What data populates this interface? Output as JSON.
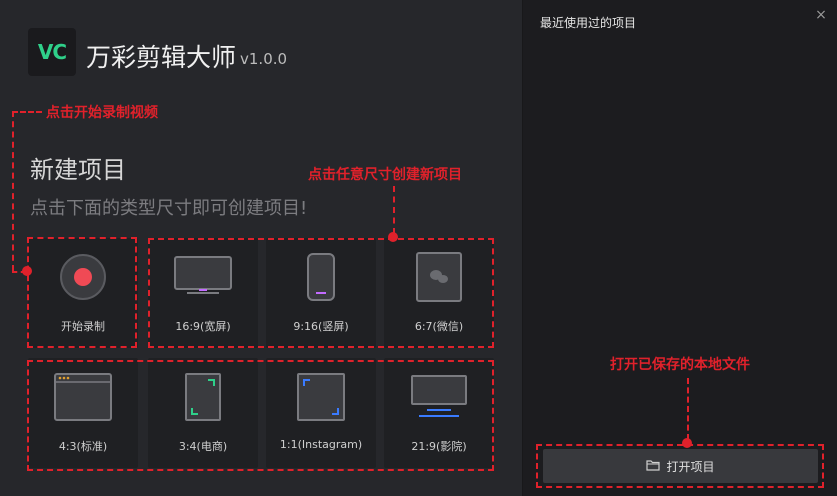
{
  "app": {
    "logo_text": "VC",
    "title": "万彩剪辑大师",
    "version": "v1.0.0"
  },
  "new_project": {
    "title": "新建项目",
    "subtitle": "点击下面的类型尺寸即可创建项目!"
  },
  "tiles": [
    {
      "label": "开始录制",
      "icon": "record-icon"
    },
    {
      "label": "16:9(宽屏)",
      "icon": "monitor-icon"
    },
    {
      "label": "9:16(竖屏)",
      "icon": "phone-icon"
    },
    {
      "label": "6:7(微信)",
      "icon": "wechat-icon"
    },
    {
      "label": "4:3(标准)",
      "icon": "window-icon"
    },
    {
      "label": "3:4(电商)",
      "icon": "portrait-frame-icon"
    },
    {
      "label": "1:1(Instagram)",
      "icon": "square-frame-icon"
    },
    {
      "label": "21:9(影院)",
      "icon": "cinema-icon"
    }
  ],
  "annotations": {
    "record": "点击开始录制视频",
    "sizes": "点击任意尺寸创建新项目",
    "open": "打开已保存的本地文件"
  },
  "recent": {
    "title": "最近使用过的项目",
    "close_symbol": "×"
  },
  "open_button": {
    "label": "打开项目"
  },
  "colors": {
    "accent_green": "#2fd08a",
    "annotation_red": "#e0212b",
    "record_red": "#f04a55",
    "highlight_purple": "#c36bff",
    "frame_teal": "#2fd08a",
    "frame_blue": "#3a7bff"
  }
}
